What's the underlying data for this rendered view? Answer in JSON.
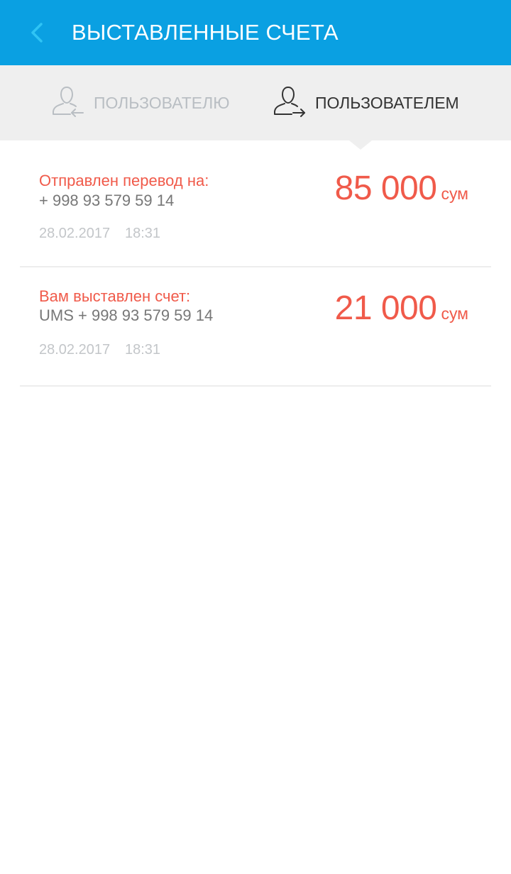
{
  "header": {
    "title": "ВЫСТАВЛЕННЫЕ СЧЕТА",
    "back_icon": "chevron-left-icon",
    "background_color": "#0aa0e2",
    "back_icon_color": "#2fc4f5"
  },
  "tabs": [
    {
      "label": "ПОЛЬЗОВАТЕЛЮ",
      "icon": "user-incoming-icon",
      "active": false,
      "color": "#b9bec3"
    },
    {
      "label": "ПОЛЬЗОВАТЕЛЕМ",
      "icon": "user-outgoing-icon",
      "active": true,
      "color": "#333333"
    }
  ],
  "invoices": [
    {
      "title": "Отправлен перевод на:",
      "phone": "+ 998 93 579 59 14",
      "date": "28.02.2017",
      "time": "18:31",
      "amount": "85 000",
      "currency": "сум"
    },
    {
      "title": "Вам выставлен счет:",
      "phone": "UMS + 998 93 579 59 14",
      "date": "28.02.2017",
      "time": "18:31",
      "amount": "21 000",
      "currency": "сум"
    }
  ],
  "colors": {
    "accent": "#f05a4a",
    "tab_bar_background": "#efefef",
    "divider": "#ededed"
  }
}
